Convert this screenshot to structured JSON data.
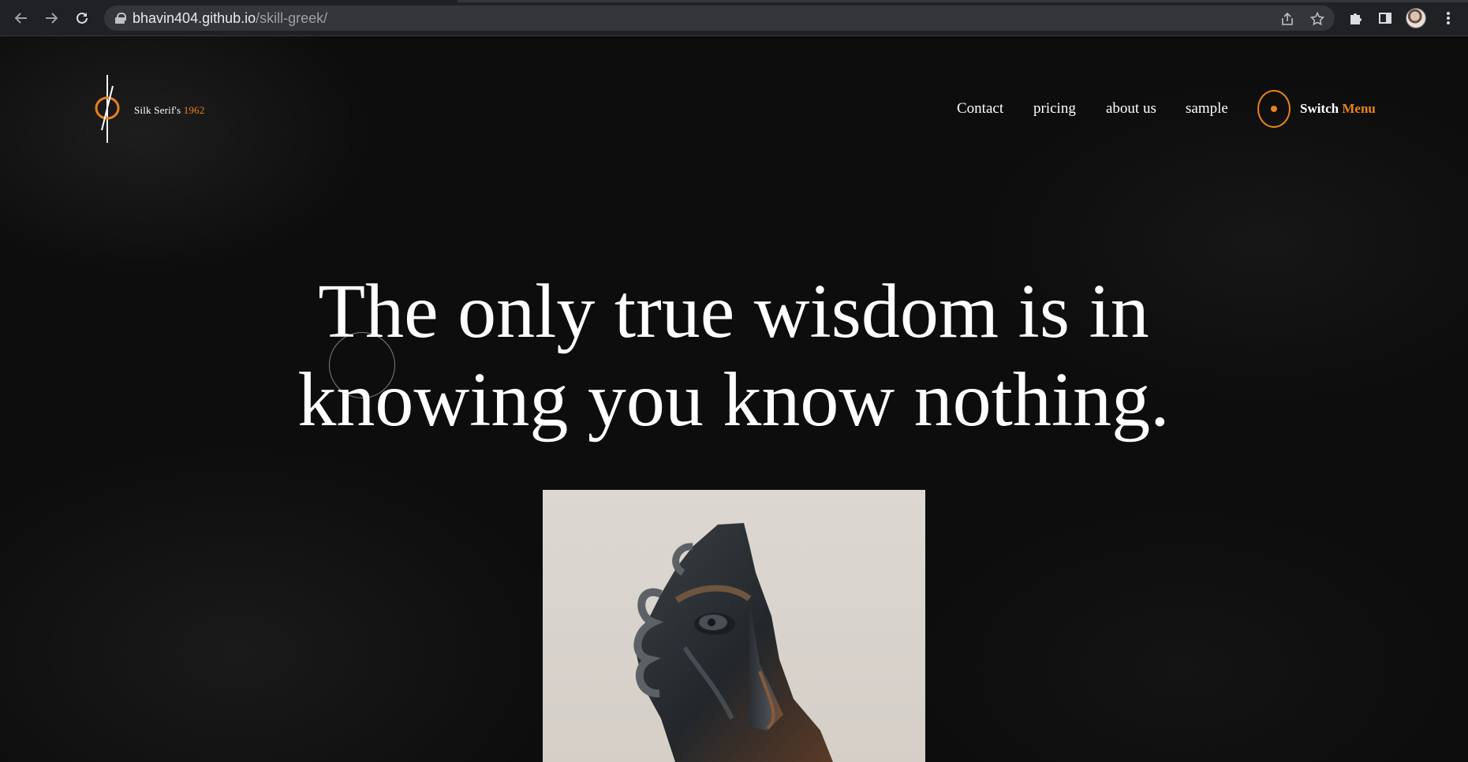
{
  "browser": {
    "url_host": "bhavin404.github.io",
    "url_path": "/skill-greek/",
    "icons": {
      "back": "arrow-left-icon",
      "forward": "arrow-right-icon",
      "reload": "reload-icon",
      "share": "share-icon",
      "bookmark": "star-icon",
      "extensions": "puzzle-icon",
      "side_panel": "side-panel-icon",
      "profile": "avatar",
      "menu": "kebab-menu-icon"
    }
  },
  "brand": {
    "name": "Silk Serif's",
    "year": "1962",
    "accent_color": "#e8821a"
  },
  "nav": {
    "items": [
      {
        "label": "Contact"
      },
      {
        "label": "pricing"
      },
      {
        "label": "about us"
      },
      {
        "label": "sample"
      }
    ],
    "switch_word1": "Switch",
    "switch_word2": "Menu"
  },
  "hero": {
    "line1": "The only true wisdom is in",
    "line2": "knowing you know nothing.",
    "image_subject": "bronze sculpture of a fragmented face"
  }
}
